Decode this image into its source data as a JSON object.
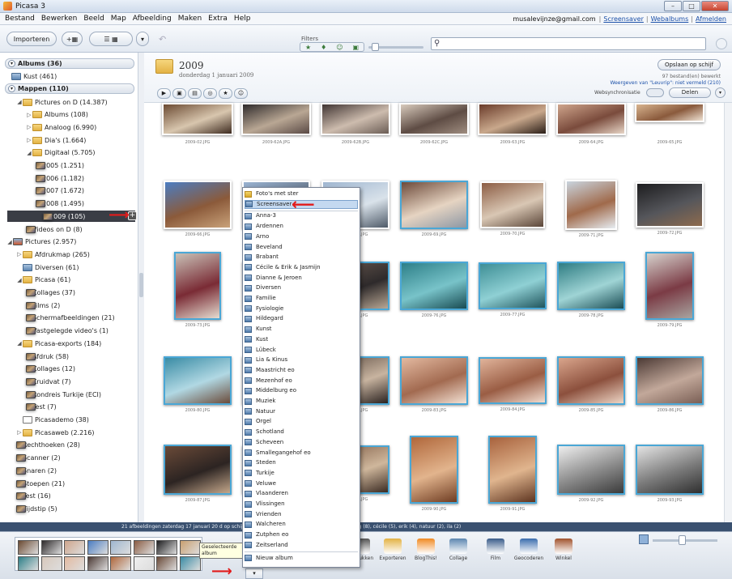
{
  "window": {
    "title": "Picasa 3",
    "buttons": [
      "–",
      "□",
      "✕"
    ]
  },
  "menubar": {
    "items": [
      "Bestand",
      "Bewerken",
      "Beeld",
      "Map",
      "Afbeelding",
      "Maken",
      "Extra",
      "Help"
    ],
    "email": "musalevijnze@gmail.com",
    "links": [
      "Screensaver",
      "Webalbums",
      "Afmelden"
    ]
  },
  "toolbar": {
    "import_label": "Importeren",
    "filters_label": "Filters",
    "filter_icons": [
      "★",
      "♦",
      "☺",
      "▣"
    ]
  },
  "sidebar": {
    "albums_header": "Albums (36)",
    "albums_item": "Kust (461)",
    "folders_header": "Mappen (110)",
    "tree": [
      {
        "label": "Pictures on D (14.387)",
        "icon": "folder",
        "indent": 2,
        "arrow": "◢"
      },
      {
        "label": "Albums (108)",
        "icon": "folder",
        "indent": 3,
        "arrow": "▷"
      },
      {
        "label": "Analoog (6.990)",
        "icon": "folder",
        "indent": 3,
        "arrow": "▷"
      },
      {
        "label": "Dia's (1.664)",
        "icon": "folder",
        "indent": 3,
        "arrow": "▷"
      },
      {
        "label": "Digitaal (5.705)",
        "icon": "folder",
        "indent": 3,
        "arrow": "◢"
      },
      {
        "label": "2005 (1.251)",
        "icon": "photo",
        "indent": 4,
        "arrow": ""
      },
      {
        "label": "2006 (1.182)",
        "icon": "photo",
        "indent": 4,
        "arrow": ""
      },
      {
        "label": "2007 (1.672)",
        "icon": "photo",
        "indent": 4,
        "arrow": ""
      },
      {
        "label": "2008 (1.495)",
        "icon": "photo",
        "indent": 4,
        "arrow": ""
      },
      {
        "label": "2009 (105)",
        "icon": "photo",
        "indent": 4,
        "arrow": "",
        "selected": true
      },
      {
        "label": "Videos on D (8)",
        "icon": "photo",
        "indent": 3,
        "arrow": ""
      },
      {
        "label": "Pictures (2.957)",
        "icon": "pc",
        "indent": 1,
        "arrow": "◢"
      },
      {
        "label": "Afdrukmap (265)",
        "icon": "folder",
        "indent": 2,
        "arrow": "▷"
      },
      {
        "label": "Diversen (61)",
        "icon": "album",
        "indent": 2,
        "arrow": ""
      },
      {
        "label": "Picasa (61)",
        "icon": "folder",
        "indent": 2,
        "arrow": "◢"
      },
      {
        "label": "Collages (37)",
        "icon": "photo",
        "indent": 3,
        "arrow": ""
      },
      {
        "label": "Films (2)",
        "icon": "photo",
        "indent": 3,
        "arrow": ""
      },
      {
        "label": "Schermafbeeldingen (21)",
        "icon": "photo",
        "indent": 3,
        "arrow": ""
      },
      {
        "label": "Vastgelegde video's (1)",
        "icon": "photo",
        "indent": 3,
        "arrow": ""
      },
      {
        "label": "Picasa-exports (184)",
        "icon": "folder",
        "indent": 2,
        "arrow": "◢"
      },
      {
        "label": "Afdruk (58)",
        "icon": "photo",
        "indent": 3,
        "arrow": ""
      },
      {
        "label": "Collages (12)",
        "icon": "photo",
        "indent": 3,
        "arrow": ""
      },
      {
        "label": "Kruidvat (7)",
        "icon": "photo",
        "indent": 3,
        "arrow": ""
      },
      {
        "label": "Rondreis Turkije (ECI)",
        "icon": "photo",
        "indent": 3,
        "arrow": ""
      },
      {
        "label": "Test (7)",
        "icon": "photo",
        "indent": 3,
        "arrow": ""
      },
      {
        "label": "Picasademo (38)",
        "icon": "web",
        "indent": 2,
        "arrow": ""
      },
      {
        "label": "Picasaweb (2.216)",
        "icon": "folder",
        "indent": 2,
        "arrow": "▷"
      },
      {
        "label": "Rechthoeken (28)",
        "icon": "photo",
        "indent": 2,
        "arrow": ""
      },
      {
        "label": "Scanner (2)",
        "icon": "photo",
        "indent": 2,
        "arrow": ""
      },
      {
        "label": "Snaren (2)",
        "icon": "photo",
        "indent": 2,
        "arrow": ""
      },
      {
        "label": "Stoepen (21)",
        "icon": "photo",
        "indent": 2,
        "arrow": ""
      },
      {
        "label": "Test (16)",
        "icon": "photo",
        "indent": 2,
        "arrow": ""
      },
      {
        "label": "Tijdstip (5)",
        "icon": "photo",
        "indent": 2,
        "arrow": ""
      }
    ]
  },
  "main": {
    "folder_title": "2009",
    "folder_date": "donderdag 1 januari 2009",
    "save_button": "Opslaan op schijf",
    "info_line1": "97 bestand(en) bewerkt",
    "info_line2": "Weergeven van \"Leuvrip\": niet vermeld (210)",
    "websync_label": "Websynchronisatie",
    "share_button": "Delen",
    "mini_buttons": [
      "▶",
      "▣",
      "▤",
      "◎",
      "★",
      "☺"
    ],
    "photos": [
      {
        "cap": "2009-02.JPG",
        "tones": [
          "#6b4a32",
          "#d8c6ae",
          "#3d2a1f"
        ]
      },
      {
        "cap": "2009-62A.JPG",
        "tones": [
          "#2e2a2b",
          "#b9a794",
          "#5a4a45"
        ]
      },
      {
        "cap": "2009-62B.JPG",
        "tones": [
          "#403432",
          "#cdbcae",
          "#6b5d55"
        ]
      },
      {
        "cap": "2009-62C.JPG",
        "tones": [
          "#d9cbbd",
          "#5e4c44",
          "#9f8d80"
        ]
      },
      {
        "cap": "2009-63.JPG",
        "tones": [
          "#6a3b2a",
          "#c9a88c",
          "#2a1e18"
        ]
      },
      {
        "cap": "2009-64.JPG",
        "tones": [
          "#cfa58c",
          "#7a4b3c",
          "#e7d5c6"
        ]
      },
      {
        "cap": "2009-65.JPG",
        "tones": [
          "#d8b48f",
          "#8a5a3c",
          "#efe2d3"
        ]
      },
      {
        "cap": "2009-66.JPG",
        "tones": [
          "#4b7dc2",
          "#8b5a3a",
          "#c9a27a"
        ]
      },
      {
        "cap": "2009-67.JPG",
        "tones": [
          "#9ab3d1",
          "#5c6a7c",
          "#4c3b2e"
        ]
      },
      {
        "cap": "2009-68.JPG",
        "tones": [
          "#9fb6d0",
          "#d9e2ea",
          "#4e5a68"
        ]
      },
      {
        "cap": "2009-69.JPG",
        "tones": [
          "#6d4a3a",
          "#e6d4c2",
          "#8d97a4"
        ]
      },
      {
        "cap": "2009-70.JPG",
        "tones": [
          "#8c5d44",
          "#d9c7b4",
          "#5a4538"
        ]
      },
      {
        "cap": "2009-71.JPG",
        "tones": [
          "#c9d4de",
          "#a06a4b",
          "#e7edf2"
        ]
      },
      {
        "cap": "2009-72.JPG",
        "tones": [
          "#1d1d1f",
          "#55565b",
          "#8e6b4e"
        ]
      },
      {
        "cap": "2009-73.JPG",
        "tones": [
          "#c9c1b7",
          "#7a2b35",
          "#e6ddd1"
        ]
      },
      {
        "cap": "2009-74.JPG",
        "tones": [
          "#c9a070",
          "#6c4a30",
          "#e5d0ad"
        ]
      },
      {
        "cap": "2009-75.JPG",
        "tones": [
          "#6a5a50",
          "#2e2a2b",
          "#b9a794"
        ]
      },
      {
        "cap": "2009-76.JPG",
        "tones": [
          "#2d7f88",
          "#78c3c9",
          "#184b52"
        ]
      },
      {
        "cap": "2009-77.JPG",
        "tones": [
          "#3f8f96",
          "#8fd0d4",
          "#20555d"
        ]
      },
      {
        "cap": "2009-78.JPG",
        "tones": [
          "#2f7d83",
          "#9fd4d5",
          "#1a4d55"
        ]
      },
      {
        "cap": "2009-79.JPG",
        "tones": [
          "#d6d2cd",
          "#7b3b45",
          "#a8a4a0"
        ]
      },
      {
        "cap": "2009-80.JPG",
        "tones": [
          "#3a8ca5",
          "#b1d8e3",
          "#6b4c3b"
        ]
      },
      {
        "cap": "2009-81.JPG",
        "tones": [
          "#d8c8bb",
          "#5a463c",
          "#9a8473"
        ]
      },
      {
        "cap": "2009-82.JPG",
        "tones": [
          "#5c4c42",
          "#c8b4a0",
          "#2a2220"
        ]
      },
      {
        "cap": "2009-83.JPG",
        "tones": [
          "#e3b9a0",
          "#a26a50",
          "#f3e1d4"
        ]
      },
      {
        "cap": "2009-84.JPG",
        "tones": [
          "#e0b39a",
          "#9a5d44",
          "#f1dccf"
        ]
      },
      {
        "cap": "2009-85.JPG",
        "tones": [
          "#d9a58c",
          "#8c503d",
          "#eed6c6"
        ]
      },
      {
        "cap": "2009-86.JPG",
        "tones": [
          "#4c3a35",
          "#c2a89a",
          "#7a5f55"
        ]
      },
      {
        "cap": "2009-87.JPG",
        "tones": [
          "#6a4a38",
          "#2c2422",
          "#c4a78b"
        ]
      },
      {
        "cap": "2009-88.JPG",
        "tones": [
          "#564238",
          "#c7ad97",
          "#2a2320"
        ]
      },
      {
        "cap": "2009-89.JPG",
        "tones": [
          "#7d5a44",
          "#cfb79c",
          "#3b2b23"
        ]
      },
      {
        "cap": "2009-90.JPG",
        "tones": [
          "#b0673b",
          "#e2b48d",
          "#6e3c22"
        ]
      },
      {
        "cap": "2009-91.JPG",
        "tones": [
          "#a8623d",
          "#e0b58e",
          "#5d3420"
        ]
      },
      {
        "cap": "2009-92.JPG",
        "tones": [
          "#efefef",
          "#8a8a8a",
          "#3b3b3b"
        ]
      },
      {
        "cap": "2009-93.JPG",
        "tones": [
          "#e4e4e4",
          "#7b7b7b",
          "#2f2f2f"
        ]
      }
    ]
  },
  "statusbar": {
    "text": "21 afbeeldingen    zaterdag 17 januari 20                                           d op schijf    Labels:jasmijn (19), mezenhof (12), middelburg (8), cécile (5), erik (4), natuur (2), ila (2)"
  },
  "tray": {
    "tooltip": "Geselecteerde album",
    "actions": [
      "Uploaden",
      "E-mail",
      "Afdrukken",
      "Exporteren",
      "BlogThis!",
      "Collage",
      "Film",
      "Geocoderen",
      "Winkel"
    ]
  },
  "popup": {
    "items": [
      "Foto's met ster",
      "Screensaver",
      "Anna-3",
      "Ardennen",
      "Arno",
      "Beveland",
      "Brabant",
      "Cécile & Erik & Jasmijn",
      "Dianne & Jeroen",
      "Diversen",
      "Familie",
      "Fysiologie",
      "Hildegard",
      "Kunst",
      "Kust",
      "Lübeck",
      "Lia & Kinus",
      "Maastricht eo",
      "Mezenhof eo",
      "Middelburg eo",
      "Muziek",
      "Natuur",
      "Orgel",
      "Schotland",
      "Scheveen",
      "Smallegangehof eo",
      "Steden",
      "Turkije",
      "Veluwe",
      "Vlaanderen",
      "Vlissingen",
      "Vrienden",
      "Walcheren",
      "Zutphen eo",
      "Zeitserland",
      "Nieuw album"
    ],
    "highlighted_index": 1
  }
}
